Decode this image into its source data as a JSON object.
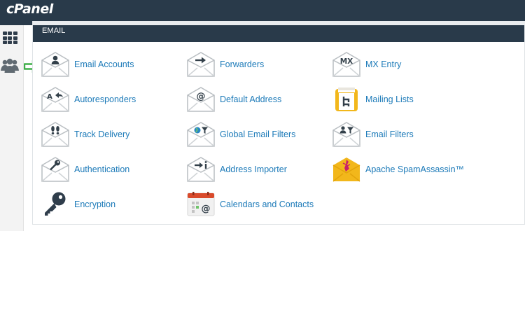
{
  "app": {
    "brand": "cPanel"
  },
  "sidebar": {
    "items": [
      {
        "name": "home-grid",
        "icon": "grid-icon"
      },
      {
        "name": "users",
        "icon": "users-icon"
      }
    ]
  },
  "panel": {
    "title": "EMAIL",
    "items": [
      {
        "label": "Email Accounts",
        "icon": "person-envelope-icon"
      },
      {
        "label": "Forwarders",
        "icon": "arrow-envelope-icon"
      },
      {
        "label": "MX Entry",
        "icon": "mx-envelope-icon"
      },
      {
        "label": "Autoresponders",
        "icon": "reply-envelope-icon"
      },
      {
        "label": "Default Address",
        "icon": "at-envelope-icon"
      },
      {
        "label": "Mailing Lists",
        "icon": "mailbox-icon"
      },
      {
        "label": "Track Delivery",
        "icon": "footprints-envelope-icon"
      },
      {
        "label": "Global Email Filters",
        "icon": "globe-filter-envelope-icon"
      },
      {
        "label": "Email Filters",
        "icon": "person-filter-envelope-icon"
      },
      {
        "label": "Authentication",
        "icon": "key-envelope-icon"
      },
      {
        "label": "Address Importer",
        "icon": "import-envelope-icon"
      },
      {
        "label": "Apache SpamAssassin™",
        "icon": "spamassassin-icon"
      },
      {
        "label": "Encryption",
        "icon": "key-icon"
      },
      {
        "label": "Calendars and Contacts",
        "icon": "calendar-contacts-icon"
      }
    ]
  },
  "colors": {
    "topbar": "#293a4a",
    "link": "#1c7ab8",
    "icon_gray": "#5f6b74",
    "accent_yellow": "#f2b71b",
    "accent_red": "#d94a2b",
    "arrow_green": "#3fae49"
  }
}
